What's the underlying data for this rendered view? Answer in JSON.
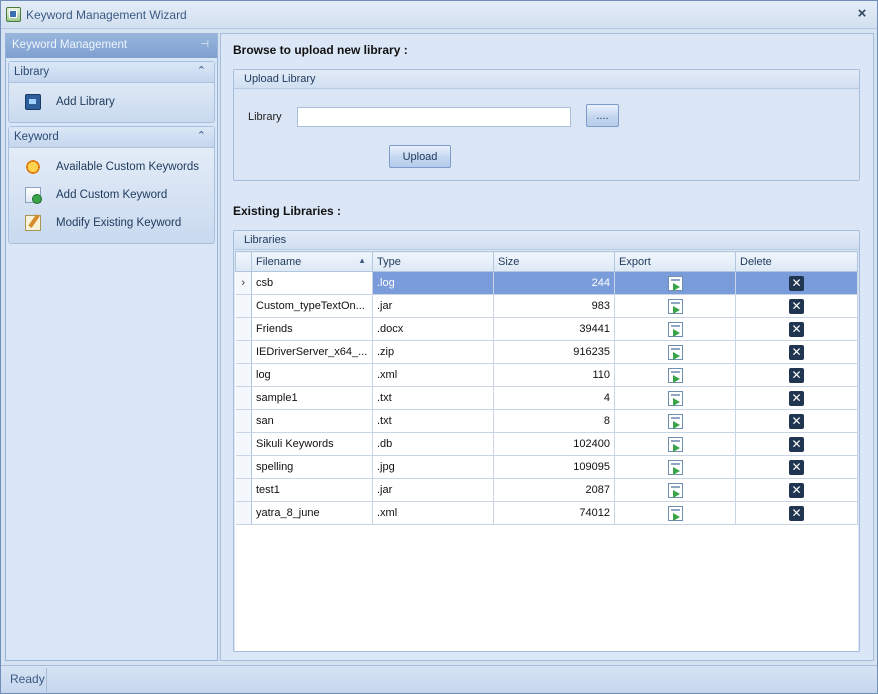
{
  "window": {
    "title": "Keyword Management Wizard",
    "close": "×"
  },
  "nav": {
    "header": "Keyword Management",
    "pin": "⊣",
    "groups": [
      {
        "title": "Library",
        "items": [
          {
            "label": "Add Library",
            "icon": "library-icon"
          }
        ]
      },
      {
        "title": "Keyword",
        "items": [
          {
            "label": "Available Custom Keywords",
            "icon": "star-icon"
          },
          {
            "label": "Add Custom Keyword",
            "icon": "add-keyword-icon"
          },
          {
            "label": "Modify Existing  Keyword",
            "icon": "edit-icon"
          }
        ]
      }
    ],
    "collapse": "⌃"
  },
  "upload": {
    "section_title": "Browse to upload new library :",
    "group_caption": "Upload Library",
    "library_label": "Library",
    "library_value": "",
    "browse_label": "....",
    "upload_label": "Upload"
  },
  "existing": {
    "section_title": "Existing Libraries :",
    "group_caption": "Libraries",
    "columns": [
      "Filename",
      "Type",
      "Size",
      "Export",
      "Delete"
    ],
    "sort_indicator": "▲",
    "row_indicator": "›",
    "delete_glyph": "✕",
    "rows": [
      {
        "filename": "csb",
        "type": ".log",
        "size": "244"
      },
      {
        "filename": "Custom_typeTextOn...",
        "type": ".jar",
        "size": "983"
      },
      {
        "filename": "Friends",
        "type": ".docx",
        "size": "39441"
      },
      {
        "filename": "IEDriverServer_x64_...",
        "type": ".zip",
        "size": "916235"
      },
      {
        "filename": "log",
        "type": ".xml",
        "size": "110"
      },
      {
        "filename": "sample1",
        "type": ".txt",
        "size": "4"
      },
      {
        "filename": "san",
        "type": ".txt",
        "size": "8"
      },
      {
        "filename": "Sikuli Keywords",
        "type": ".db",
        "size": "102400"
      },
      {
        "filename": "spelling",
        "type": ".jpg",
        "size": "109095"
      },
      {
        "filename": "test1",
        "type": ".jar",
        "size": "2087"
      },
      {
        "filename": "yatra_8_june",
        "type": ".xml",
        "size": "74012"
      }
    ],
    "selected_row": 0
  },
  "status": {
    "text": "Ready"
  },
  "colors": {
    "accent": "#7b9cda",
    "frame": "#d5e2f2",
    "delete": "#1f3550",
    "export_arrow": "#3aa348"
  }
}
